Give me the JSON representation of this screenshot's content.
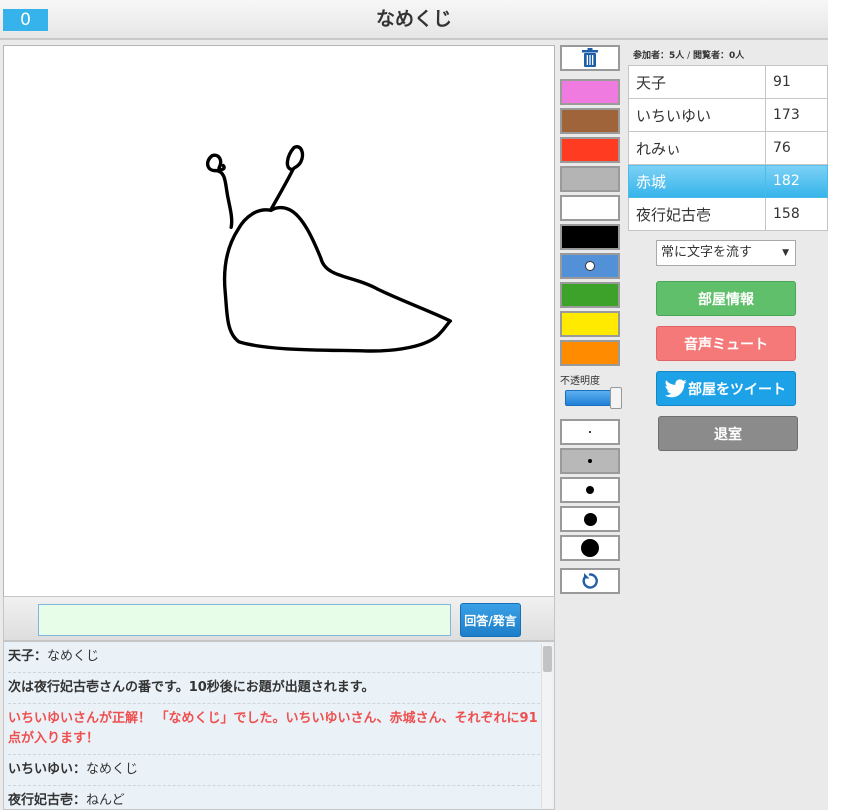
{
  "header": {
    "counter": "0",
    "title": "なめくじ"
  },
  "tools": {
    "trash_icon": "trash-icon",
    "colors": [
      {
        "name": "pink",
        "hex": "#f07be0",
        "selected": false
      },
      {
        "name": "brown",
        "hex": "#a0643a",
        "selected": false
      },
      {
        "name": "red",
        "hex": "#ff3b22",
        "selected": false
      },
      {
        "name": "gray",
        "hex": "#b4b4b4",
        "selected": false
      },
      {
        "name": "white",
        "hex": "#ffffff",
        "selected": false
      },
      {
        "name": "black",
        "hex": "#000000",
        "selected": true
      },
      {
        "name": "blue",
        "hex": "#5291d8",
        "selected": false
      },
      {
        "name": "green",
        "hex": "#3ca22a",
        "selected": false
      },
      {
        "name": "yellow",
        "hex": "#ffea00",
        "selected": false
      },
      {
        "name": "orange",
        "hex": "#ff8c00",
        "selected": false
      }
    ],
    "opacity_label": "不透明度",
    "opacity_value": 1.0,
    "brush_sizes": [
      1,
      2,
      3,
      4,
      5
    ],
    "selected_brush_size": 2,
    "undo_icon": "undo-icon"
  },
  "answer": {
    "value": "",
    "button_label": "回答/発言"
  },
  "chat": [
    {
      "kind": "user",
      "name": "天子",
      "sep": "：",
      "text": "なめくじ"
    },
    {
      "kind": "system",
      "text": "次は夜行妃古壱さんの番です。10秒後にお題が出題されます。"
    },
    {
      "kind": "correct",
      "text": "いちいゆいさんが正解！ 「なめくじ」でした。いちいゆいさん、赤城さん、それぞれに91点が入ります！"
    },
    {
      "kind": "user",
      "name": "いちいゆい",
      "sep": "：",
      "text": "なめくじ"
    },
    {
      "kind": "user",
      "name": "夜行妃古壱",
      "sep": "：",
      "text": "ねんど"
    }
  ],
  "room": {
    "participants_label": "参加者：5人",
    "divider": " / ",
    "viewers_label": "閲覧者：0人"
  },
  "players": [
    {
      "name": "天子",
      "score": "91",
      "active": false
    },
    {
      "name": "いちいゆい",
      "score": "173",
      "active": false
    },
    {
      "name": "れみぃ",
      "score": "76",
      "active": false
    },
    {
      "name": "赤城",
      "score": "182",
      "active": true
    },
    {
      "name": "夜行妃古壱",
      "score": "158",
      "active": false
    }
  ],
  "flow_select": {
    "selected": "常に文字を流す"
  },
  "buttons": {
    "room_info": "部屋情報",
    "mute": "音声ミュート",
    "tweet": "部屋をツイート",
    "leave": "退室"
  }
}
